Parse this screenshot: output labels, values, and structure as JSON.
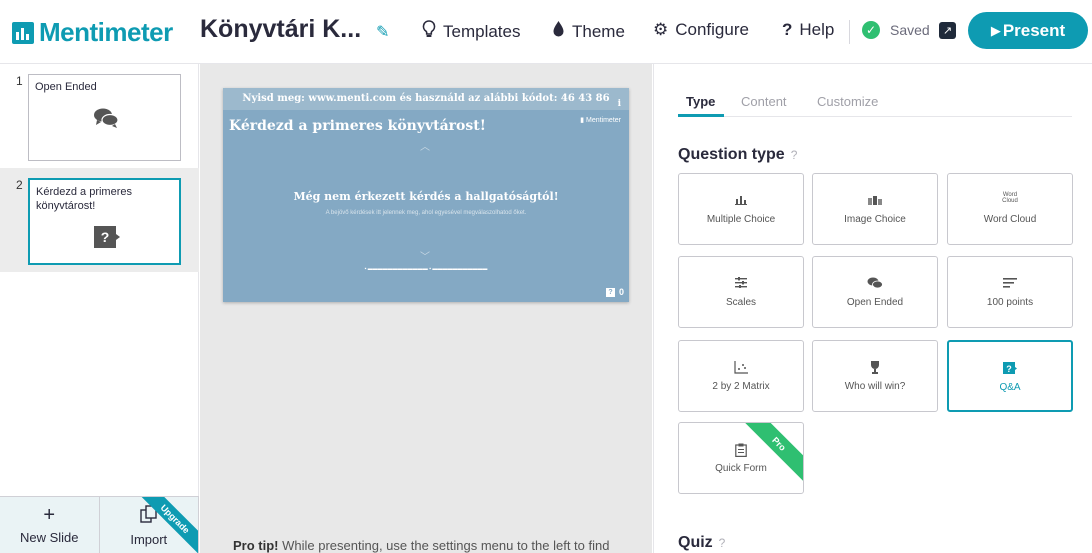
{
  "header": {
    "logo_text": "Mentimeter",
    "presentation_title": "Könyvtári K...",
    "nav": {
      "templates": "Templates",
      "theme": "Theme",
      "configure": "Configure",
      "help": "Help"
    },
    "saved_label": "Saved",
    "present_label": "Present"
  },
  "sidebar": {
    "slides": [
      {
        "number": "1",
        "title": "Open Ended"
      },
      {
        "number": "2",
        "title": "Kérdezd a primeres könyvtárost!"
      }
    ],
    "new_slide": "New Slide",
    "import": "Import",
    "upgrade": "Upgrade"
  },
  "canvas": {
    "slide": {
      "top_bar_prefix": "Nyisd meg: ",
      "top_bar_url": "www.menti.com",
      "top_bar_suffix": " és használd az alábbi kódot: 46 43 86",
      "info": "i",
      "heading": "Kérdezd a primeres könyvtárost!",
      "brand": "Mentimeter",
      "message": "Még nem érkezett kérdés a hallgatóságtól!",
      "subtext": "A bejövő kérdések itt jelennek meg, ahol egyesével megválaszolhatod őket.",
      "count": "0"
    },
    "protip_label": "Pro tip!",
    "protip_text": " While presenting, use the settings menu to the left to find"
  },
  "panel": {
    "tabs": [
      "Type",
      "Content",
      "Customize"
    ],
    "question_type_heading": "Question type",
    "help_mark": "?",
    "question_types": [
      {
        "label": "Multiple Choice",
        "icon": "bar-chart-icon"
      },
      {
        "label": "Image Choice",
        "icon": "image-choice-icon"
      },
      {
        "label": "Word Cloud",
        "icon": "word-cloud-icon"
      },
      {
        "label": "Scales",
        "icon": "sliders-icon"
      },
      {
        "label": "Open Ended",
        "icon": "speech-bubbles-icon"
      },
      {
        "label": "100 points",
        "icon": "lines-icon"
      },
      {
        "label": "2 by 2 Matrix",
        "icon": "matrix-icon"
      },
      {
        "label": "Who will win?",
        "icon": "trophy-icon"
      },
      {
        "label": "Q&A",
        "icon": "qa-icon"
      },
      {
        "label": "Quick Form",
        "icon": "clipboard-icon"
      }
    ],
    "selected_type": "Q&A",
    "pro_label": "Pro",
    "quiz_heading": "Quiz"
  },
  "colors": {
    "accent": "#0e9bb2",
    "saved_green": "#2fbf71",
    "slide_bg": "#84a9c4"
  }
}
